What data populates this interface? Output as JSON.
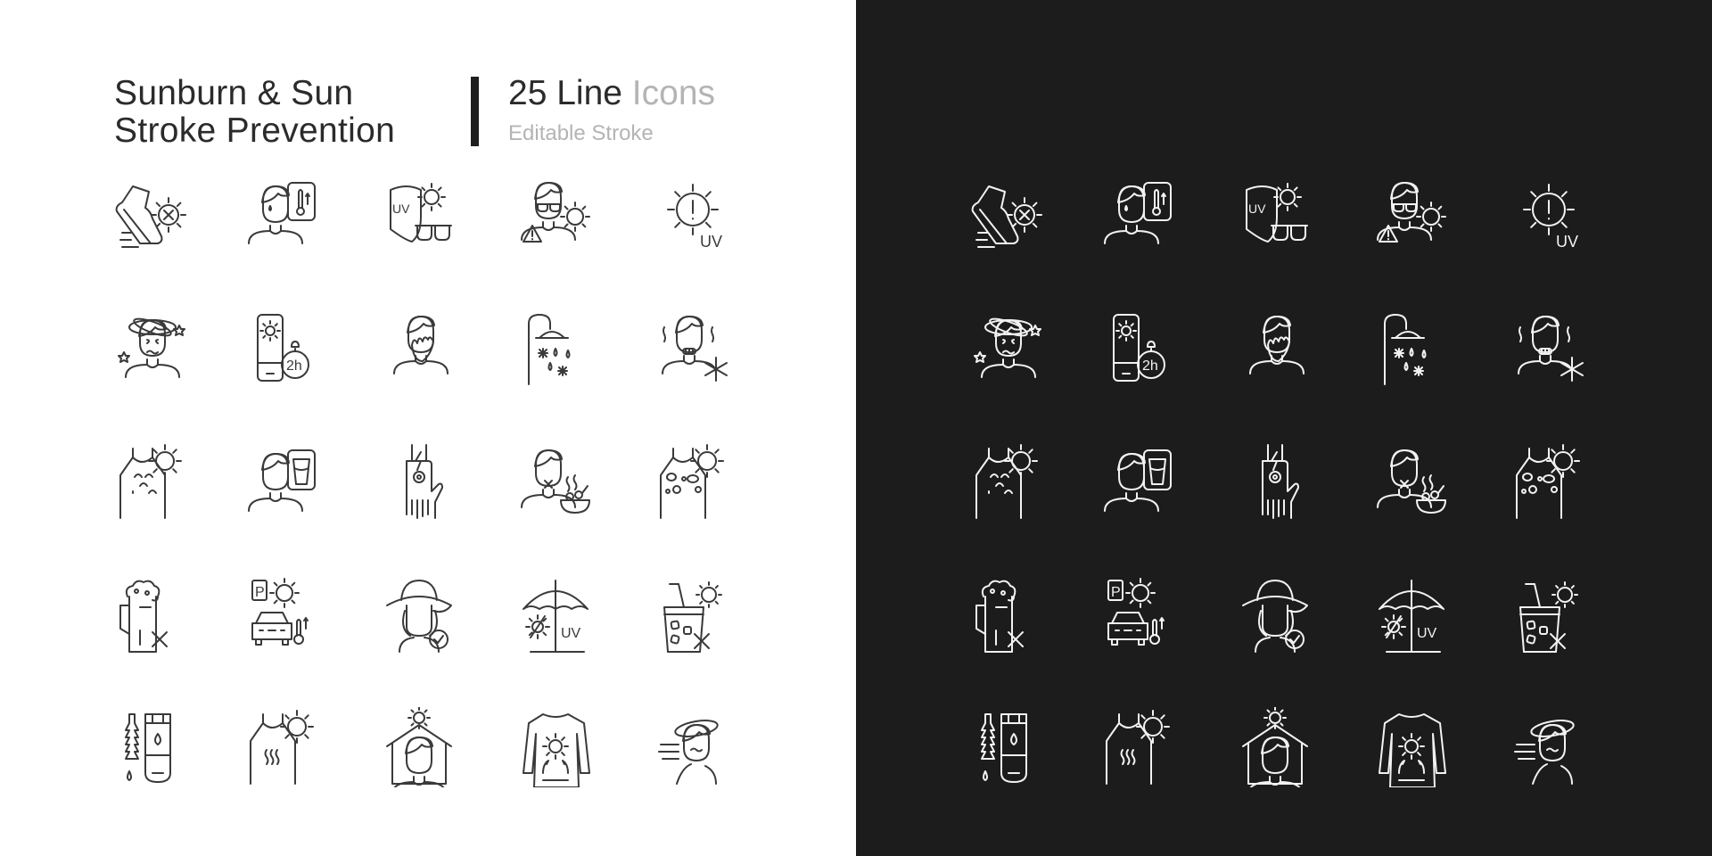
{
  "header": {
    "title_line1": "Sunburn & Sun",
    "title_line2": "Stroke Prevention",
    "count_dark": "25 Line",
    "count_light": "Icons",
    "subtitle": "Editable Stroke"
  },
  "colors": {
    "light_background": "#ffffff",
    "dark_background": "#1c1c1c",
    "stroke_light": "#3a3a3a",
    "stroke_dark": "#f2f2f2",
    "muted_text": "#b4b4b4"
  },
  "icons": [
    {
      "id": "shoe-no-sun",
      "uv_text": ""
    },
    {
      "id": "sweating-person-thermometer",
      "uv_text": ""
    },
    {
      "id": "uv-shield-sunglasses",
      "uv_text": "UV"
    },
    {
      "id": "person-sunglasses-warning",
      "uv_text": ""
    },
    {
      "id": "sun-uv-warning",
      "uv_text": "UV"
    },
    {
      "id": "dizzy-person",
      "uv_text": ""
    },
    {
      "id": "sunscreen-reapply-timer",
      "uv_text": "2h"
    },
    {
      "id": "person-yawning",
      "uv_text": ""
    },
    {
      "id": "cold-shower",
      "uv_text": ""
    },
    {
      "id": "person-chills",
      "uv_text": ""
    },
    {
      "id": "sunburned-back-blisters",
      "uv_text": ""
    },
    {
      "id": "person-drink-water",
      "uv_text": ""
    },
    {
      "id": "hand-numbness",
      "uv_text": ""
    },
    {
      "id": "person-nausea-food",
      "uv_text": ""
    },
    {
      "id": "sunburned-skin-peeling",
      "uv_text": ""
    },
    {
      "id": "no-alcohol",
      "uv_text": ""
    },
    {
      "id": "hot-parked-car",
      "uv_text": "P"
    },
    {
      "id": "woman-sun-hat",
      "uv_text": ""
    },
    {
      "id": "beach-umbrella-uv",
      "uv_text": "UV"
    },
    {
      "id": "no-sugary-drinks",
      "uv_text": ""
    },
    {
      "id": "aloe-vera-gel",
      "uv_text": ""
    },
    {
      "id": "sunburned-shoulders-heat",
      "uv_text": ""
    },
    {
      "id": "stay-indoors-midday",
      "uv_text": ""
    },
    {
      "id": "sun-protective-clothing",
      "uv_text": ""
    },
    {
      "id": "fainting-person",
      "uv_text": ""
    }
  ]
}
